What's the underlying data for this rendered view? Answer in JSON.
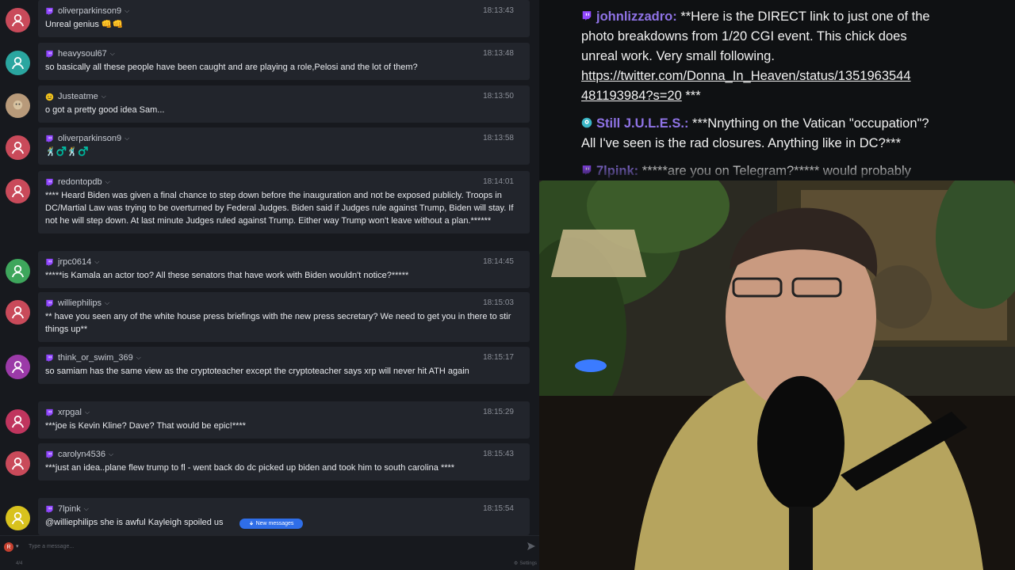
{
  "chat": {
    "messages": [
      {
        "user": "oliverparkinson9",
        "time": "18:13:43",
        "text": "Unreal genius 👊👊",
        "avatar_color": "#c94a5a",
        "badge": "twitch"
      },
      {
        "user": "heavysoul67",
        "time": "18:13:48",
        "text": "so basically all these people have been caught and are playing a role,Pelosi and the lot of them?",
        "avatar_color": "#2aa6a0",
        "badge": "twitch"
      },
      {
        "user": "Justeatme",
        "time": "18:13:50",
        "text": "o got a pretty good idea Sam...",
        "avatar_color": "#b89a7a",
        "badge": "smile"
      },
      {
        "user": "oliverparkinson9",
        "time": "18:13:58",
        "text": "🕺♂️🕺♂️",
        "avatar_color": "#c94a5a",
        "badge": "twitch"
      },
      {
        "user": "redontopdb",
        "time": "18:14:01",
        "text": "**** Heard Biden was given a final chance to step down before the inauguration and not be exposed publicly. Troops in DC/Martial Law was trying to be overturned by Federal Judges. Biden said if Judges rule against Trump, Biden will stay. If not he will step down. At last minute Judges ruled against Trump. Either way Trump won't leave without a plan.******",
        "avatar_color": "#c94a5a",
        "badge": "twitch"
      },
      {
        "user": "jrpc0614",
        "time": "18:14:45",
        "text": "*****is Kamala an actor too? All these senators that have work with Biden wouldn't notice?*****",
        "avatar_color": "#3ea65c",
        "badge": "twitch"
      },
      {
        "user": "williephilips",
        "time": "18:15:03",
        "text": "** have you seen any of the white house press briefings with the new press secretary? We need to get you in there to stir things up**",
        "avatar_color": "#c94a5a",
        "badge": "twitch"
      },
      {
        "user": "think_or_swim_369",
        "time": "18:15:17",
        "text": "so samiam has the same view as the cryptoteacher except the cryptoteacher says xrp will never hit ATH again",
        "avatar_color": "#9b3aa8",
        "badge": "twitch"
      },
      {
        "user": "xrpgal",
        "time": "18:15:29",
        "text": "***joe is Kevin Kline? Dave? That would be epic!****",
        "avatar_color": "#c0355e",
        "badge": "twitch"
      },
      {
        "user": "carolyn4536",
        "time": "18:15:43",
        "text": "***just an idea..plane flew trump to fl - went back do dc picked up biden and took him to south carolina ****",
        "avatar_color": "#c94a5a",
        "badge": "twitch"
      },
      {
        "user": "7lpink",
        "time": "18:15:54",
        "text": "@williephilips she is awful Kayleigh spoiled us",
        "avatar_color": "#d8c21e",
        "badge": "twitch"
      }
    ],
    "new_messages_label": "New messages",
    "composer": {
      "placeholder": "Type a message...",
      "avatar_letter": "R",
      "count": "4/4",
      "settings_label": "Settings"
    }
  },
  "overlay": {
    "messages": [
      {
        "user": "johnlizzadro:",
        "lines": [
          "**Here is the DIRECT link to just one of the",
          "photo breakdowns from 1/20 CGI event. This chick does",
          "unreal work. Very small following."
        ],
        "link_lines": [
          "https://twitter.com/Donna_In_Heaven/status/1351963544",
          "481193984?s=20"
        ],
        "tail": " ***",
        "user_color": "#8f73e6",
        "badge": "twitch"
      },
      {
        "user": "Still J.U.L.E.S.:",
        "lines": [
          "***Nnything on the Vatican \"occupation\"?",
          "All I've seen is the rad closures. Anything like in DC?***"
        ],
        "user_color": "#8f73e6",
        "badge": "periscope"
      },
      {
        "user": "7lpink:",
        "lines": [
          "*****are you on Telegram?***** would probably"
        ],
        "user_color": "#8f73e6",
        "badge": "twitch"
      }
    ]
  },
  "colors": {
    "chat_bg": "#17191e",
    "bubble_bg": "#22252c",
    "accent": "#2f6ee8",
    "twitch_purple": "#9147ff"
  }
}
